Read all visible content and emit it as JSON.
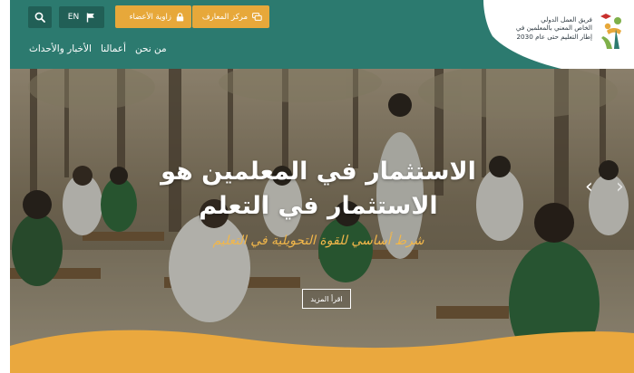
{
  "header": {
    "lang_label": "EN",
    "members_label": "زاوية الأعضاء",
    "knowledge_label": "مركز المعارف",
    "nav": [
      "من نحن",
      "أعمالنا",
      "الأخبار والأحداث"
    ],
    "logo_lines": [
      "فريق العمل الدولي",
      "الخاص المعني بالمعلمين في",
      "إطار التعليم حتى عام 2030"
    ]
  },
  "hero": {
    "headline_line1": "الاستثمار في المعلمين هو",
    "headline_line2": "الاستثمار في التعلم",
    "subline": "شرط أساسي للقوة التحويلية في التعليم",
    "read_more": "اقرأ المزيد"
  },
  "colors": {
    "header_teal": "#2c7a6f",
    "accent_orange": "#e7a83a",
    "subline_yellow": "#f2b74a",
    "wave_orange": "#eaa83e"
  },
  "icons": {
    "search": "search-icon",
    "language": "flag-icon",
    "members": "lock-icon",
    "knowledge": "chat-icon",
    "prev": "chevron-left-icon",
    "next": "chevron-right-icon"
  }
}
